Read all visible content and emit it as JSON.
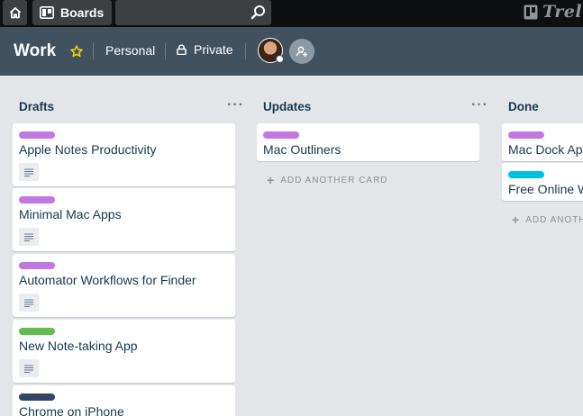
{
  "topbar": {
    "home_icon": "home-icon",
    "boards_label": "Boards",
    "search": {
      "value": "",
      "placeholder": ""
    },
    "logo_text": "Trello"
  },
  "board": {
    "title": "Work",
    "team": "Personal",
    "visibility": "Private",
    "colors": {
      "header_bg": "#41515e",
      "star": "#f2d600"
    }
  },
  "lists": [
    {
      "title": "Drafts",
      "cards": [
        {
          "title": "Apple Notes Productivity",
          "label_color": "#c377e0",
          "has_description": true
        },
        {
          "title": "Minimal Mac Apps",
          "label_color": "#c377e0",
          "has_description": true
        },
        {
          "title": "Automator Workflows for Finder",
          "label_color": "#c377e0",
          "has_description": true
        },
        {
          "title": "New Note-taking App",
          "label_color": "#61bd4f",
          "has_description": true
        },
        {
          "title": "Chrome on iPhone",
          "label_color": "#344563",
          "has_description": false
        }
      ]
    },
    {
      "title": "Updates",
      "cards": [
        {
          "title": "Mac Outliners",
          "label_color": "#c377e0",
          "has_description": false
        }
      ],
      "add_card_label": "ADD ANOTHER CARD"
    },
    {
      "title": "Done",
      "cards": [
        {
          "title": "Mac Dock Ap",
          "label_color": "#c377e0",
          "has_description": false
        },
        {
          "title": "Free Online W",
          "label_color": "#00c2e0",
          "has_description": false
        }
      ],
      "add_card_label": "ADD ANOTH"
    }
  ]
}
